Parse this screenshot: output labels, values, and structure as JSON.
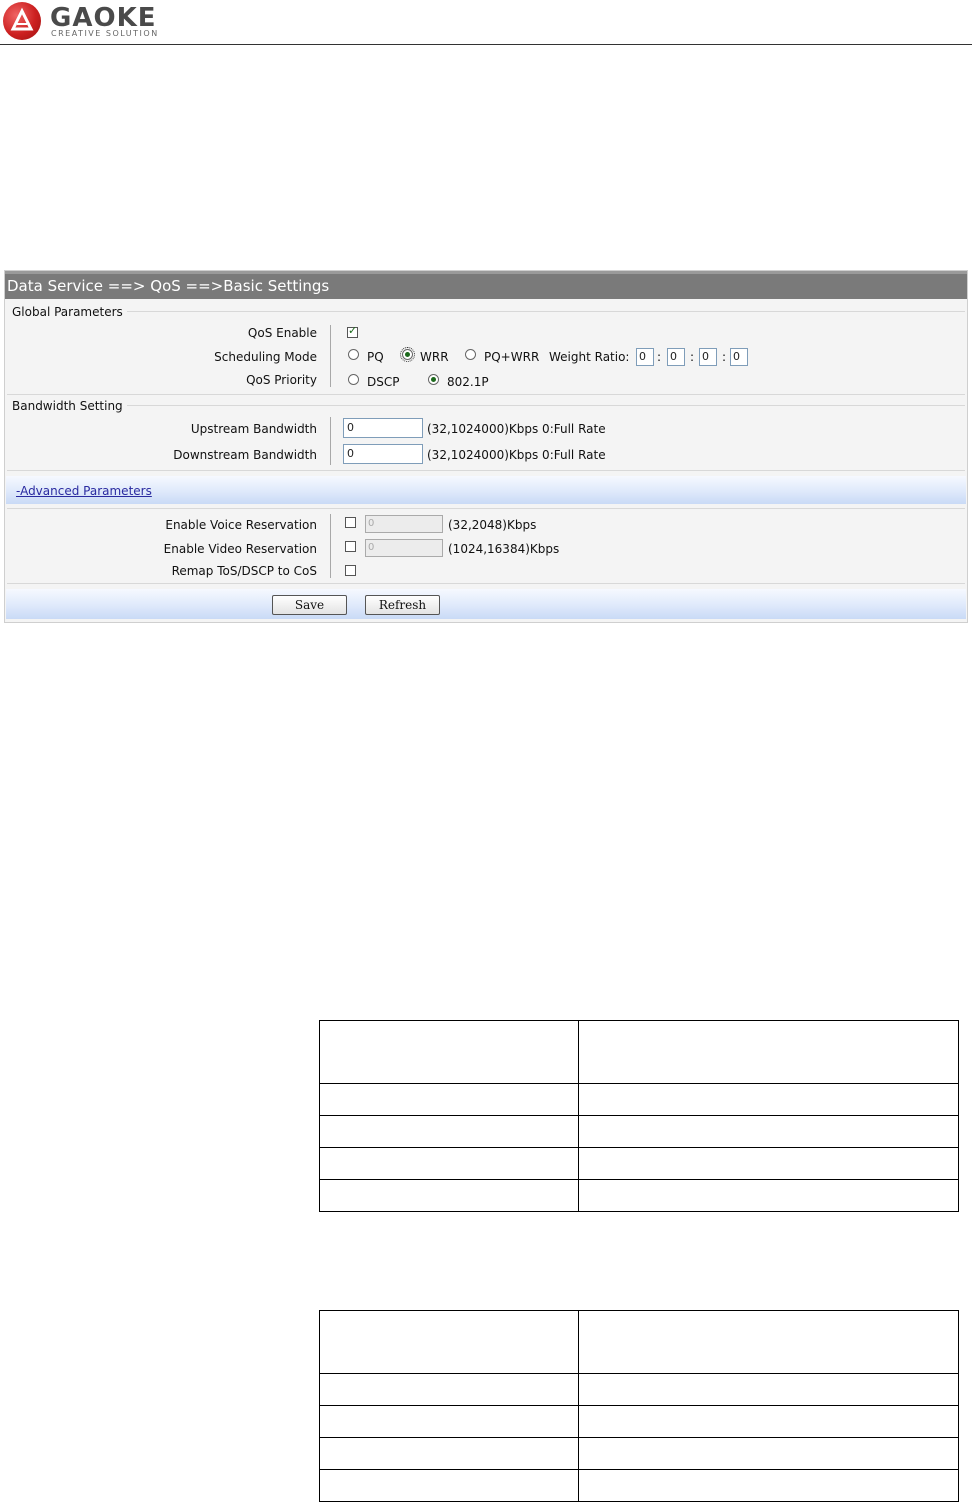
{
  "logo": {
    "name": "GAOKE",
    "tagline": "CREATIVE SOLUTION"
  },
  "panel": {
    "title": "Data Service ==> QoS ==>Basic Settings",
    "global": {
      "section_label": "Global Parameters",
      "qos_enable_label": "QoS Enable",
      "qos_enable_checked": true,
      "scheduling_label": "Scheduling Mode",
      "scheduling_options": [
        "PQ",
        "WRR",
        "PQ+WRR"
      ],
      "scheduling_selected": "WRR",
      "weight_ratio_label": "Weight Ratio:",
      "weight_ratio_values": [
        "0",
        "0",
        "0",
        "0"
      ],
      "ratio_separator": ":",
      "priority_label": "QoS Priority",
      "priority_options": [
        "DSCP",
        "802.1P"
      ],
      "priority_selected": "802.1P"
    },
    "bandwidth": {
      "section_label": "Bandwidth Setting",
      "upstream_label": "Upstream Bandwidth",
      "upstream_value": "0",
      "upstream_hint": "(32,1024000)Kbps 0:Full Rate",
      "downstream_label": "Downstream Bandwidth",
      "downstream_value": "0",
      "downstream_hint": "(32,1024000)Kbps 0:Full Rate"
    },
    "advanced": {
      "link_label": "-Advanced Parameters",
      "voice_label": "Enable Voice Reservation",
      "voice_checked": false,
      "voice_value": "0",
      "voice_hint": "(32,2048)Kbps",
      "video_label": "Enable Video Reservation",
      "video_checked": false,
      "video_value": "0",
      "video_hint": "(1024,16384)Kbps",
      "remap_label": "Remap ToS/DSCP to CoS",
      "remap_checked": false
    },
    "buttons": {
      "save": "Save",
      "refresh": "Refresh"
    }
  },
  "colors": {
    "title_bar": "#7a7a7a",
    "panel_bg": "#f4f4f4",
    "band_blue": "#c9daf6",
    "link": "#2a2aa0",
    "logo_red": "#cc2020"
  }
}
